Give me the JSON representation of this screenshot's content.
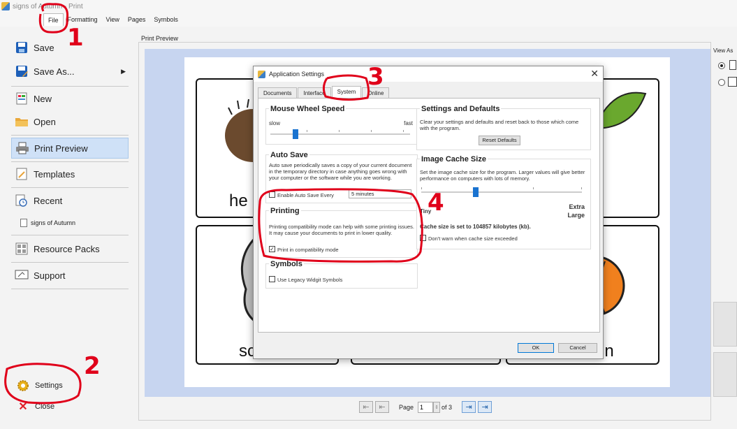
{
  "window": {
    "title": "signs of Autumn - Print"
  },
  "menu": {
    "items": [
      "File",
      "Formatting",
      "View",
      "Pages",
      "Symbols"
    ]
  },
  "sidebar": {
    "save": "Save",
    "save_as": "Save As...",
    "new": "New",
    "open": "Open",
    "print_preview": "Print Preview",
    "templates": "Templates",
    "recent": "Recent",
    "recent_file": "signs of Autumn",
    "resource_packs": "Resource Packs",
    "support": "Support",
    "settings": "Settings",
    "close": "Close"
  },
  "preview": {
    "label": "Print Preview",
    "card_words": [
      "he",
      "sc",
      "in"
    ]
  },
  "pager": {
    "label": "Page",
    "value": "1",
    "of": "of 3"
  },
  "right_panel": {
    "view_as": "View As"
  },
  "dialog": {
    "title": "Application Settings",
    "tabs": [
      "Documents",
      "Interface",
      "System",
      "Online"
    ],
    "mouse_wheel": {
      "title": "Mouse Wheel Speed",
      "slow": "slow",
      "fast": "fast",
      "value_fraction": 0.18
    },
    "auto_save": {
      "title": "Auto Save",
      "desc": "Auto save periodically saves a copy of your current document in the temporary directory in case anything goes wrong with your computer or the software while you are working.",
      "enable_label": "Enable Auto Save Every",
      "interval": "5 minutes"
    },
    "printing": {
      "title": "Printing",
      "desc": "Printing compatibility mode can help with some printing issues. It may cause your documents to print in lower quality.",
      "checkbox_label": "Print in compatibility mode",
      "checked": true
    },
    "symbols": {
      "title": "Symbols",
      "checkbox_label": "Use Legacy Widgit Symbols"
    },
    "defaults": {
      "title": "Settings and Defaults",
      "desc": "Clear your settings and defaults and reset back to those which come with the program.",
      "reset_button": "Reset Defaults"
    },
    "cache": {
      "title": "Image Cache Size",
      "desc": "Set the image cache size for the program. Larger values will give better performance on computers with lots of memory.",
      "min_label": "Tiny",
      "max_label_1": "Extra",
      "max_label_2": "Large",
      "status": "Cache size is set to 104857 kilobytes (kb).",
      "warn_label": "Don't warn when cache size exceeded",
      "value_fraction": 0.34
    },
    "ok": "OK",
    "cancel": "Cancel"
  },
  "annotations": [
    "1",
    "2",
    "3",
    "4"
  ],
  "colors": {
    "annotation": "#e0001a",
    "accent": "#1a73d0",
    "preview_bg": "#c7d5f0"
  }
}
